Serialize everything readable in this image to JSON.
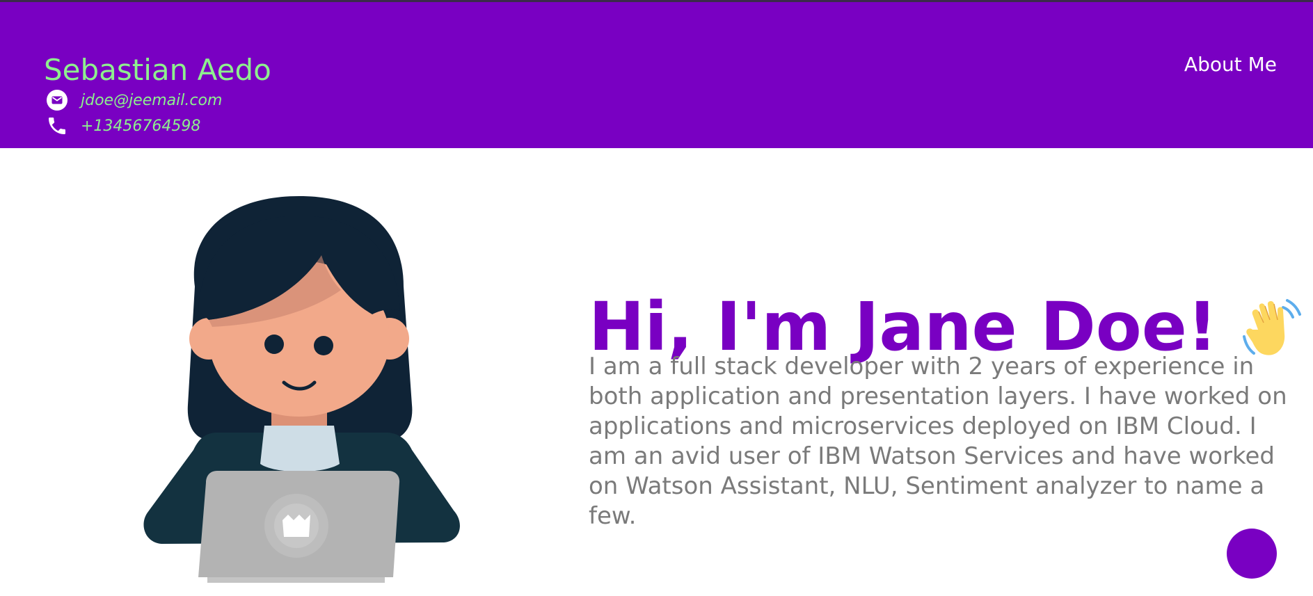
{
  "header": {
    "name": "Sebastian Aedo",
    "email": "jdoe@jeemail.com",
    "phone": "+13456764598",
    "nav": {
      "about_label": "About Me"
    },
    "icons": {
      "email": "email-icon",
      "phone": "phone-icon"
    }
  },
  "hero": {
    "title": "Hi, I'm Jane Doe!",
    "title_icon": "waving-hand-icon",
    "bio": "I am a full stack developer with 2 years of experience in both application and presentation layers. I have worked on applications and microservices deployed on IBM Cloud. I am an avid user of IBM Watson Services and have worked on Watson Assistant, NLU, Sentiment analyzer to name a few."
  },
  "colors": {
    "header_bg": "#7900c2",
    "brand_text": "#8ef08e",
    "title": "#7900c2",
    "body_text": "#7a7a7a",
    "fab": "#7900c2"
  }
}
